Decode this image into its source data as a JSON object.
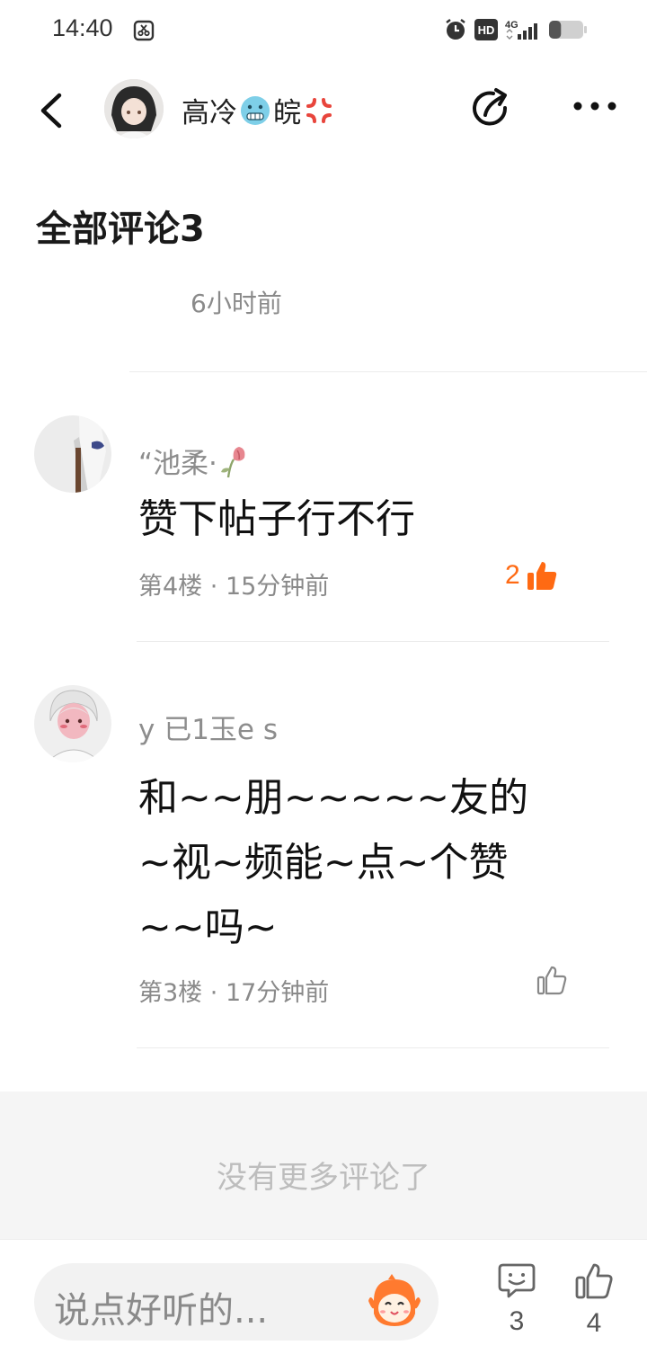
{
  "status_bar": {
    "time": "14:40",
    "network": "4G",
    "hd_label": "HD",
    "battery_level": 0.35
  },
  "header": {
    "title_part1": "高冷",
    "title_part2": "皖",
    "icons": [
      "back-icon",
      "share-icon",
      "more-icon"
    ]
  },
  "section": {
    "title": "全部评论3",
    "prev_time": "6小时前"
  },
  "comments": [
    {
      "user": "“池柔·",
      "text": "赞下帖子行不行",
      "floor": "第4楼",
      "time": "15分钟前",
      "likes": "2",
      "liked": true
    },
    {
      "user": "y 已1玉e s",
      "text": "和~~朋~~~~~友的~视~频能~点~个赞~~吗~",
      "floor": "第3楼",
      "time": "17分钟前",
      "likes": "",
      "liked": false
    }
  ],
  "footer": {
    "no_more": "没有更多评论了"
  },
  "bottom_bar": {
    "input_placeholder": "说点好听的...",
    "comment_count": "3",
    "like_count": "4"
  },
  "colors": {
    "accent": "#ff6a13",
    "muted_text": "#8a8a8a",
    "divider": "#ececec",
    "no_more_bg": "#f5f5f5"
  }
}
